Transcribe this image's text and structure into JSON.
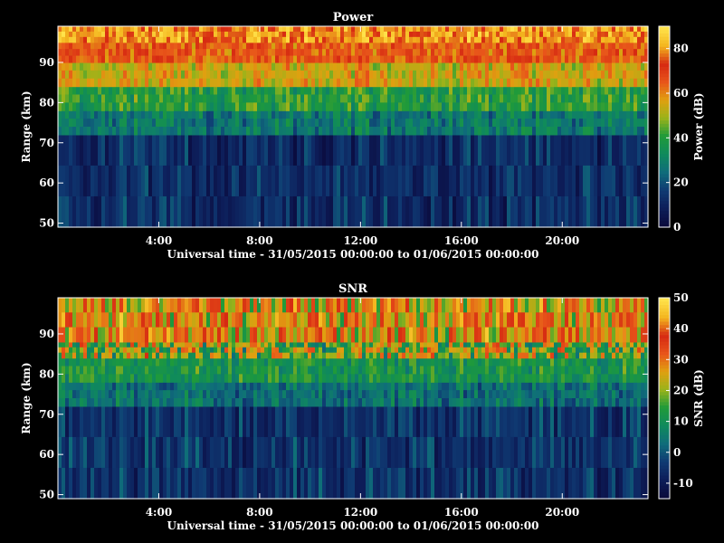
{
  "colors": {
    "background": "#000000",
    "foreground": "#ffffff",
    "colormap": [
      "#0a0a3c",
      "#0d1e5a",
      "#0f3b73",
      "#0f6d7a",
      "#0f8a5c",
      "#1f9a3a",
      "#9ab31a",
      "#e0a010",
      "#e8551a",
      "#d62a12",
      "#f3b51e",
      "#ffe24a"
    ]
  },
  "chart_data": [
    {
      "type": "heatmap",
      "title": "Power",
      "xlabel": "Universal time - 31/05/2015 00:00:00 to 01/06/2015 00:00:00",
      "ylabel": "Range (km)",
      "x_ticks": [
        "4:00",
        "8:00",
        "12:00",
        "16:00",
        "20:00"
      ],
      "x_tick_hours": [
        4,
        8,
        12,
        16,
        20
      ],
      "xlim_hours": [
        0,
        23.4
      ],
      "y_ticks": [
        50,
        60,
        70,
        80,
        90
      ],
      "ylim": [
        49,
        99
      ],
      "colorbar_label": "Power (dB)",
      "colorbar_ticks": [
        0,
        20,
        40,
        60,
        80
      ],
      "colorbar_range": [
        0,
        90
      ],
      "bands": [
        {
          "range_km": [
            49,
            72
          ],
          "level": 12
        },
        {
          "range_km": [
            72,
            78
          ],
          "level": 28
        },
        {
          "range_km": [
            78,
            84
          ],
          "level": 40
        },
        {
          "range_km": [
            84,
            90
          ],
          "level": 55
        },
        {
          "range_km": [
            90,
            95
          ],
          "level": 66
        },
        {
          "range_km": [
            95,
            99
          ],
          "level": 80
        }
      ]
    },
    {
      "type": "heatmap",
      "title": "SNR",
      "xlabel": "Universal time - 31/05/2015 00:00:00 to 01/06/2015 00:00:00",
      "ylabel": "Range (km)",
      "x_ticks": [
        "4:00",
        "8:00",
        "12:00",
        "16:00",
        "20:00"
      ],
      "x_tick_hours": [
        4,
        8,
        12,
        16,
        20
      ],
      "xlim_hours": [
        0,
        23.4
      ],
      "y_ticks": [
        50,
        60,
        70,
        80,
        90
      ],
      "ylim": [
        49,
        99
      ],
      "colorbar_label": "SNR (dB)",
      "colorbar_ticks": [
        -10,
        0,
        10,
        20,
        30,
        40,
        50
      ],
      "colorbar_range": [
        -15,
        50
      ],
      "bands": [
        {
          "range_km": [
            49,
            72
          ],
          "level": -5
        },
        {
          "range_km": [
            72,
            78
          ],
          "level": 4
        },
        {
          "range_km": [
            78,
            84
          ],
          "level": 12
        },
        {
          "range_km": [
            84,
            88
          ],
          "level": 20
        },
        {
          "range_km": [
            88,
            99
          ],
          "level": 30
        }
      ]
    }
  ]
}
